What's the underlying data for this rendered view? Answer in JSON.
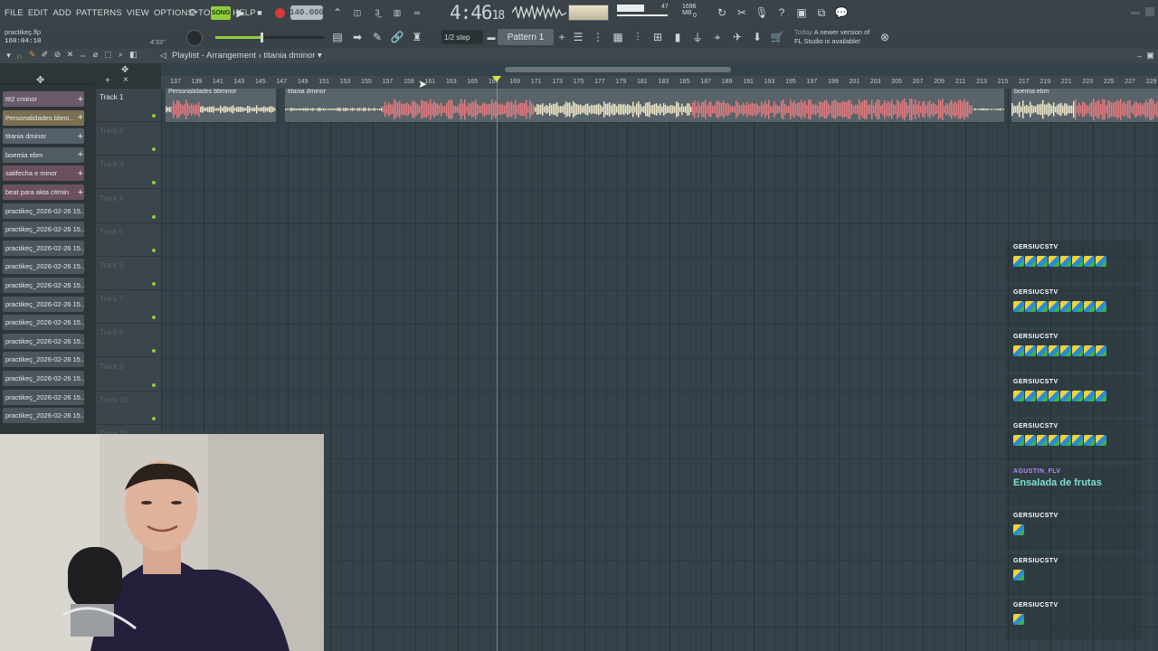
{
  "menubar": [
    "FILE",
    "EDIT",
    "ADD",
    "PATTERNS",
    "VIEW",
    "OPTIONS",
    "TOOLS",
    "HELP"
  ],
  "transport": {
    "mode_label": "SONG",
    "tempo": "140.000",
    "time_main": "4:46",
    "time_sub": "18",
    "cpu_value": "47",
    "memory": "1696 MB",
    "voices": "0"
  },
  "project": {
    "name": "practikeç.flp",
    "position": "160:04:10",
    "length": "4'33\""
  },
  "toolbar2": {
    "snap": "1/2 step",
    "pattern": "Pattern 1",
    "update_day": "Today",
    "update_line1": "A newer version of",
    "update_line2": "FL Studio is available!"
  },
  "playlist": {
    "title": "Playlist - Arrangement",
    "arrangement_name": "titania dminor"
  },
  "patterns": [
    "ttt2 cminor",
    "Personalidades bbmi...",
    "titania dminor",
    "boemia ebm",
    "satifecha e minor",
    "beat para akta c#min",
    "practikeç_2026-02-26 15...",
    "practikeç_2026-02-26 15...",
    "practikeç_2026-02-26 15...",
    "practikeç_2026-02-26 15...",
    "practikeç_2026-02-26 15...",
    "practikeç_2026-02-26 15...",
    "practikeç_2026-02-26 15...",
    "practikeç_2026-02-26 15...",
    "practikeç_2026-02-26 15...",
    "practikeç_2026-02-26 15...",
    "practikeç_2026-02-26 15...",
    "practikeç_2026-02-26 15..."
  ],
  "tracks": [
    "Track 1",
    "Track 2",
    "Track 3",
    "Track 4",
    "Track 5",
    "Track 6",
    "Track 7",
    "Track 8",
    "Track 9",
    "Track 10",
    "Track 11"
  ],
  "ruler_ticks": [
    "137",
    "139",
    "141",
    "143",
    "145",
    "147",
    "149",
    "151",
    "153",
    "155",
    "157",
    "159",
    "161",
    "163",
    "165",
    "167",
    "169",
    "171",
    "173",
    "175",
    "177",
    "179",
    "181",
    "183",
    "185",
    "187",
    "189",
    "191",
    "193",
    "195",
    "197",
    "199",
    "201",
    "203",
    "205",
    "207",
    "209",
    "211",
    "213",
    "215",
    "217",
    "219",
    "221",
    "223",
    "225",
    "227",
    "229"
  ],
  "clips": [
    {
      "name": "Personalidades bbminor"
    },
    {
      "name": "titania dminor"
    },
    {
      "name": "boemia ebm"
    }
  ],
  "chat": [
    {
      "user": "GERSIUCSTV",
      "type": "emotes",
      "count": 8
    },
    {
      "user": "GERSIUCSTV",
      "type": "emotes",
      "count": 8
    },
    {
      "user": "GERSIUCSTV",
      "type": "emotes",
      "count": 8
    },
    {
      "user": "GERSIUCSTV",
      "type": "emotes",
      "count": 8
    },
    {
      "user": "GERSIUCSTV",
      "type": "emotes",
      "count": 8
    },
    {
      "user": "AGUSTIN_FLV",
      "type": "text",
      "text": "Ensalada de frutas"
    },
    {
      "user": "GERSIUCSTV",
      "type": "emotes",
      "count": 1
    },
    {
      "user": "GERSIUCSTV",
      "type": "emotes",
      "count": 1
    },
    {
      "user": "GERSIUCSTV",
      "type": "emotes",
      "count": 1
    }
  ],
  "colors": {
    "accent_green": "#8ccf3a",
    "clip_red": "#e07a7e",
    "clip_cream": "#efe6c8",
    "chat_text": "#7ee0cf",
    "chat_user_alt": "#b98cf5"
  }
}
